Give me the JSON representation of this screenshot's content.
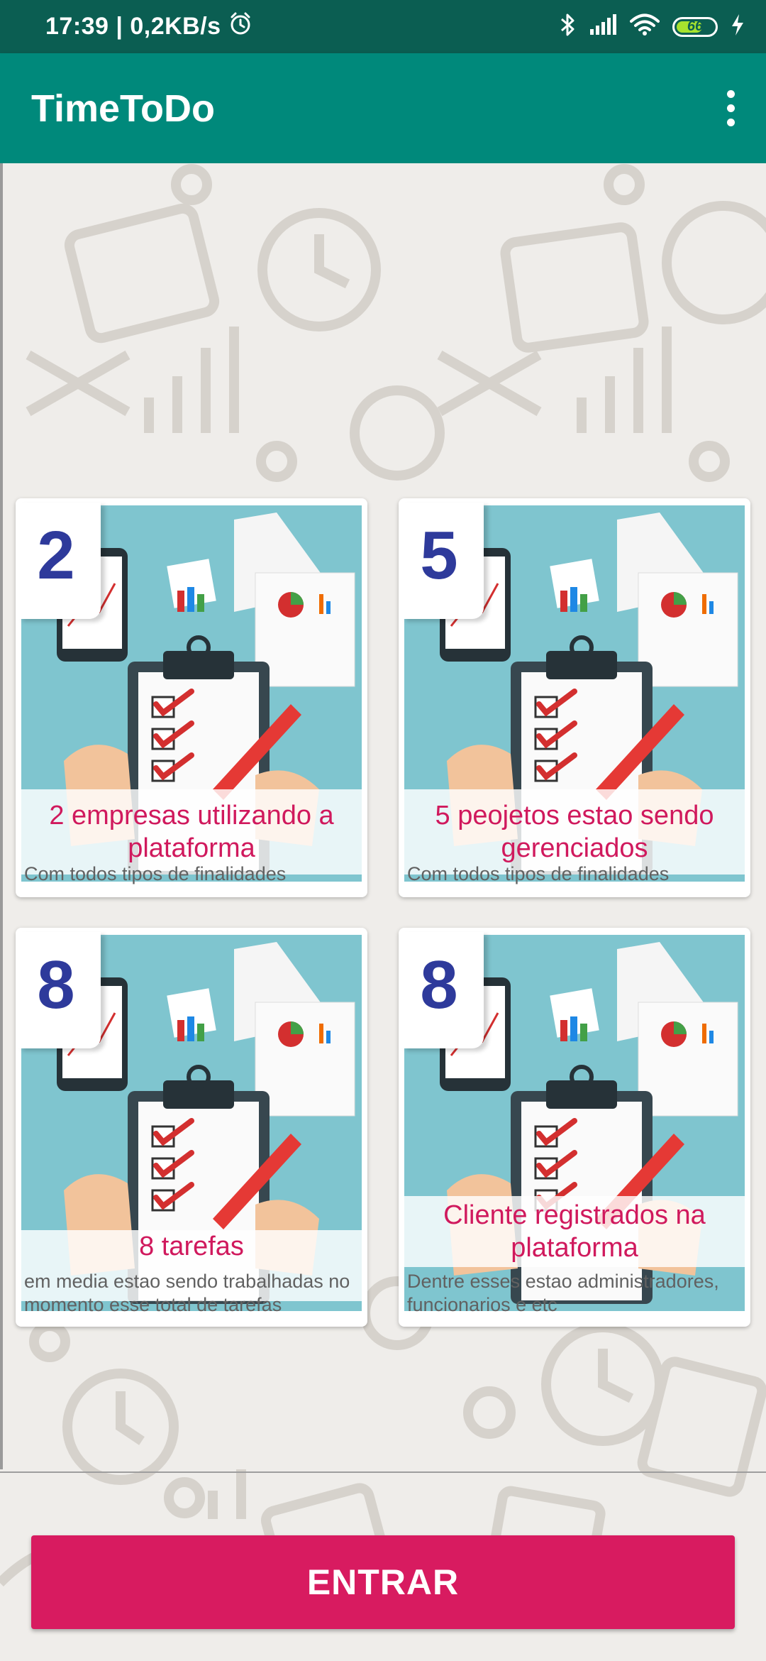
{
  "status_bar": {
    "time_speed": "17:39 | 0,2KB/s",
    "battery_level": "66",
    "icons": [
      "alarm-icon",
      "bluetooth-icon",
      "signal-icon",
      "wifi-icon",
      "battery-icon",
      "charging-icon"
    ]
  },
  "app_bar": {
    "title": "TimeToDo",
    "menu_icon": "more-vertical-icon"
  },
  "cards": [
    {
      "number": "2",
      "title": "2 empresas utilizando a plataforma",
      "subtitle": "Com todos tipos de finalidades"
    },
    {
      "number": "5",
      "title": "5 peojetos estao sendo gerenciados",
      "subtitle": "Com todos tipos de finalidades"
    },
    {
      "number": "8",
      "title": "8 tarefas",
      "subtitle": "em media estao sendo trabalhadas no momento esse total de tarefas"
    },
    {
      "number": "8",
      "title": "Cliente registrados na plataforma",
      "subtitle": "Dentre esses estao administradores, funcionarios e etc"
    }
  ],
  "actions": {
    "enter_label": "ENTRAR"
  },
  "colors": {
    "status_bar": "#0b5e52",
    "app_bar": "#00897b",
    "accent": "#d81b60",
    "number": "#2e3a9b",
    "illustration_bg": "#7fc5cf"
  }
}
